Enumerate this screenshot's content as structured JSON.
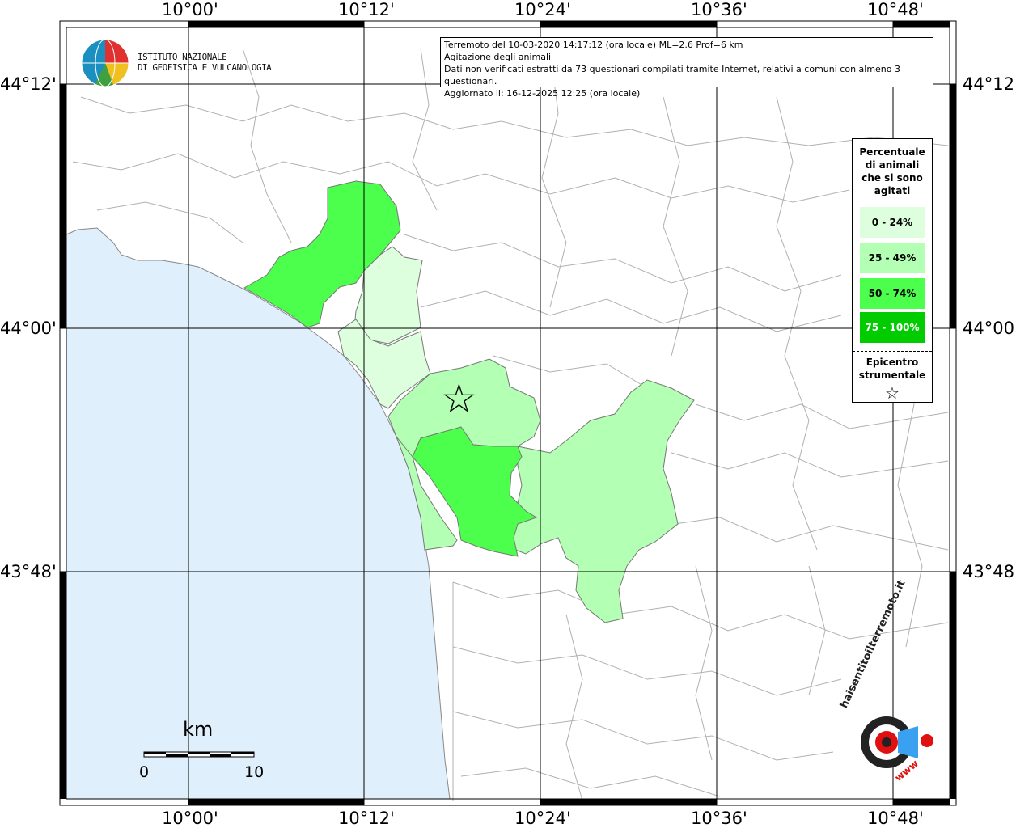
{
  "header": {
    "line1": "Terremoto del 10-03-2020 14:17:12 (ora locale) ML=2.6 Prof=6 km",
    "line2": "Agitazione degli animali",
    "line3": "Dati non verificati estratti da 73 questionari compilati tramite Internet, relativi a comuni con almeno 3 questionari.",
    "line4": "Aggiornato il: 16-12-2025 12:25 (ora locale)"
  },
  "logo": {
    "line1": "ISTITUTO NAZIONALE",
    "line2": "DI GEOFISICA E VULCANOLOGIA"
  },
  "axes": {
    "lon_top": [
      "10°00'",
      "10°12'",
      "10°24'",
      "10°36'",
      "10°48'"
    ],
    "lon_bottom": [
      "10°00'",
      "10°12'",
      "10°24'",
      "10°36'",
      "10°48'"
    ],
    "lat_left": [
      "44°12'",
      "44°00'",
      "43°48'"
    ],
    "lat_right": [
      "44°12'",
      "44°00'",
      "43°48'"
    ]
  },
  "legend": {
    "title": "Percentuale di animali che si sono agitati",
    "classes": [
      {
        "label": "0 - 24%",
        "color": "#ddffdd"
      },
      {
        "label": "25 - 49%",
        "color": "#b3ffb3"
      },
      {
        "label": "50 - 74%",
        "color": "#4dff4d"
      },
      {
        "label": "75 - 100%",
        "color": "#00cc00"
      }
    ],
    "epicenter_label": "Epicentro strumentale",
    "epicenter_symbol": "☆"
  },
  "scale": {
    "title": "km",
    "min": "0",
    "max": "10"
  },
  "watermark": {
    "text": "haisentitoilterremoto.it",
    "sub": "www"
  },
  "colors": {
    "sea": "#dff0fc",
    "border": "#aaaaaa",
    "grid": "#000000"
  }
}
